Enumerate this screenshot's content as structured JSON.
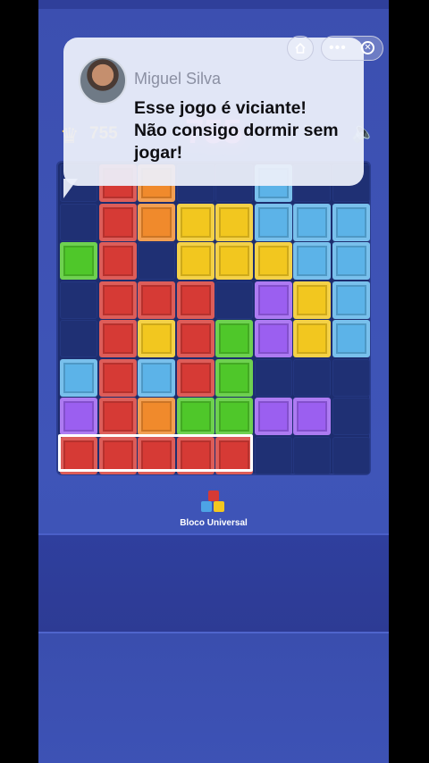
{
  "game": {
    "best_score": "755",
    "current_score": "755",
    "brand_label": "Bloco Universal"
  },
  "notification": {
    "sender": "Miguel Silva",
    "message": "Esse jogo é viciante!\nNão consigo dormir sem jogar!"
  },
  "icons": {
    "home": "home-icon",
    "more": "more-icon",
    "close": "close-icon",
    "crown": "crown-icon",
    "restart": "restart-icon",
    "sound": "sound-icon"
  },
  "colors": {
    "r": "#d63a35",
    "o": "#f08a2c",
    "y": "#f2c71f",
    "g": "#4fc72a",
    "b": "#5cb3e8",
    "p": "#9b5ff0"
  },
  "board": {
    "rows": [
      "_ro__b__",
      "_royybbb",
      "gr_yyybb",
      "_rrr_pyb",
      "_ryrgpyb",
      "brbrg___",
      "proggpp_",
      "rrrrr___"
    ]
  }
}
